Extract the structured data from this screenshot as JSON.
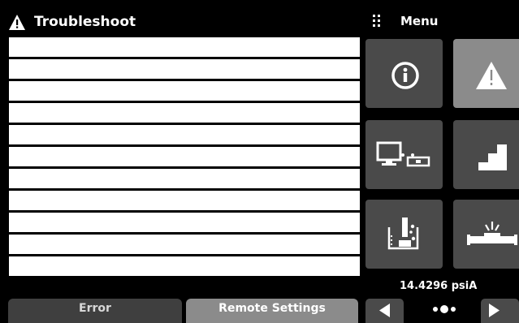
{
  "header": {
    "title": "Troubleshoot",
    "warning_icon": "warning-triangle-icon",
    "menu_icon": "grip-dots-icon",
    "menu_label": "Menu"
  },
  "list": {
    "rows": [
      "",
      "",
      "",
      "",
      "",
      "",
      "",
      "",
      "",
      "",
      ""
    ]
  },
  "tiles": [
    {
      "name": "info-tile",
      "icon": "info-circle-icon",
      "active": false
    },
    {
      "name": "troubleshoot-tile",
      "icon": "warning-triangle-icon",
      "active": true
    },
    {
      "name": "remote-tile",
      "icon": "computer-remote-icon",
      "active": false
    },
    {
      "name": "program-tile",
      "icon": "staircase-icon",
      "active": false
    },
    {
      "name": "leak-test-tile",
      "icon": "beaker-level-icon",
      "active": false
    },
    {
      "name": "burst-tile",
      "icon": "burst-pipe-icon",
      "active": false
    }
  ],
  "status": {
    "pressure": "14.4296 psiA"
  },
  "tabs": {
    "error_label": "Error",
    "remote_label": "Remote Settings"
  },
  "pager": {
    "prev_icon": "triangle-left-icon",
    "next_icon": "triangle-right-icon",
    "page_indicator_icon": "page-dots-icon"
  },
  "colors": {
    "background": "#000000",
    "tile": "#4a4a4a",
    "tile_active": "#8b8b8b",
    "row": "#ffffff"
  }
}
